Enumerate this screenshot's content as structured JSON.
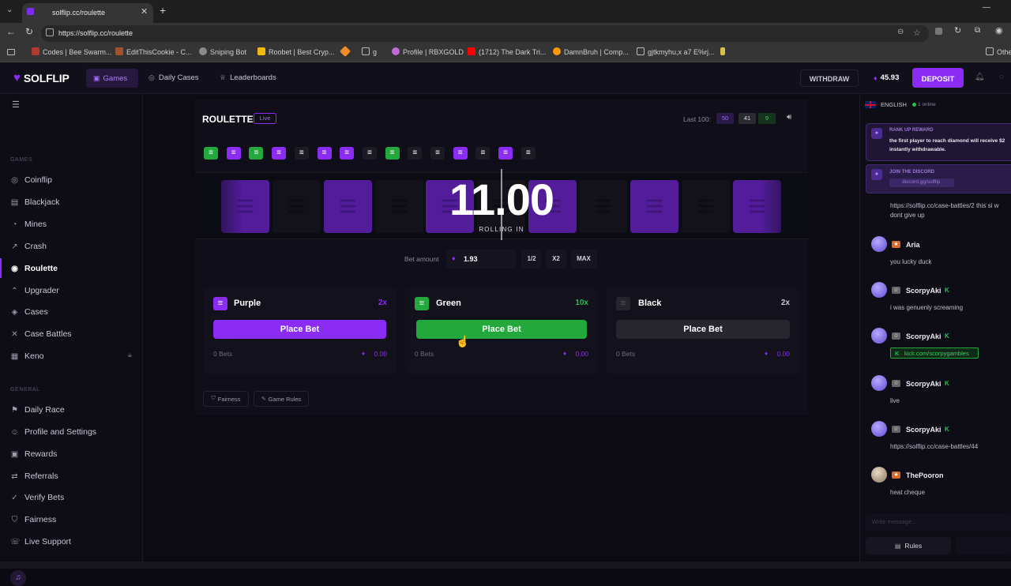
{
  "browser": {
    "tab_title": "solflip.cc/roulette",
    "url": "https://solflip.cc/roulette",
    "bookmarks": [
      {
        "label": "Codes | Bee Swarm...",
        "color": "#b03a2e"
      },
      {
        "label": "EditThisCookie - C...",
        "color": "#a0522d"
      },
      {
        "label": "Sniping Bot",
        "color": "#8a8a8a"
      },
      {
        "label": "Roobet | Best Cryp...",
        "color": "#f0b90b"
      },
      {
        "label": "",
        "color": "#f28c28"
      },
      {
        "label": "g",
        "color": "#aaaaaa"
      },
      {
        "label": "Profile | RBXGOLD",
        "color": "#c06bd6"
      },
      {
        "label": "(1712) The Dark Tri...",
        "color": "#ff0000"
      },
      {
        "label": "DamnBruh | Comp...",
        "color": "#ff9900"
      },
      {
        "label": "gjtkmyhu,x a7 E%rj...",
        "color": "#aaaaaa"
      }
    ],
    "other_bookmarks": "Othe"
  },
  "nav": {
    "logo": "SOLFLIP",
    "items": [
      {
        "label": "Games",
        "active": true
      },
      {
        "label": "Daily Cases",
        "active": false
      },
      {
        "label": "Leaderboards",
        "active": false
      }
    ],
    "withdraw": "WITHDRAW",
    "balance": "45.93",
    "deposit": "DEPOSIT"
  },
  "sidebar": {
    "games_header": "GAMES",
    "games": [
      {
        "label": "Coinflip",
        "icon": "coin-icon"
      },
      {
        "label": "Blackjack",
        "icon": "cards-icon"
      },
      {
        "label": "Mines",
        "icon": "bomb-icon"
      },
      {
        "label": "Crash",
        "icon": "rocket-icon"
      },
      {
        "label": "Roulette",
        "icon": "roulette-icon",
        "active": true
      },
      {
        "label": "Upgrader",
        "icon": "upgrade-icon"
      },
      {
        "label": "Cases",
        "icon": "case-icon"
      },
      {
        "label": "Case Battles",
        "icon": "swords-icon"
      },
      {
        "label": "Keno",
        "icon": "grid-icon",
        "locked": true
      }
    ],
    "general_header": "GENERAL",
    "general": [
      {
        "label": "Daily Race",
        "icon": "flag-icon"
      },
      {
        "label": "Profile and Settings",
        "icon": "user-icon"
      },
      {
        "label": "Rewards",
        "icon": "gift-icon"
      },
      {
        "label": "Referrals",
        "icon": "referral-icon"
      },
      {
        "label": "Verify Bets",
        "icon": "check-icon"
      },
      {
        "label": "Fairness",
        "icon": "shield-icon"
      },
      {
        "label": "Live Support",
        "icon": "support-icon"
      }
    ]
  },
  "game": {
    "title": "ROULETTE",
    "live_badge": "Live",
    "last100_label": "Last 100:",
    "last100": {
      "purple": "50",
      "black": "41",
      "green": "9"
    },
    "history": [
      "green",
      "purple",
      "green",
      "purple",
      "black",
      "purple",
      "purple",
      "black",
      "green",
      "black",
      "black",
      "purple",
      "black",
      "purple",
      "black"
    ],
    "countdown": "11.00",
    "rolling_label": "ROLLING IN",
    "bet_amount_label": "Bet amount",
    "bet_amount": "1.93",
    "half": "1/2",
    "double": "X2",
    "max": "MAX",
    "options": [
      {
        "name": "Purple",
        "multiplier": "2x",
        "button": "Place Bet",
        "bets": "0 Bets",
        "total": "0.00",
        "color": "#8b2cf5"
      },
      {
        "name": "Green",
        "multiplier": "10x",
        "button": "Place Bet",
        "bets": "0 Bets",
        "total": "0.00",
        "color": "#22a83c"
      },
      {
        "name": "Black",
        "multiplier": "2x",
        "button": "Place Bet",
        "bets": "0 Bets",
        "total": "0.00",
        "color": "#2a2a2f"
      }
    ],
    "fairness": "Fairness",
    "game_rules": "Game Rules"
  },
  "chat": {
    "language": "ENGLISH",
    "online": "1 online",
    "banner1_title": "RANK UP REWARD",
    "banner1_text1": "the first player to reach diamond will receive $2",
    "banner1_text2": "instantly withdrawable.",
    "banner2_title": "JOIN THE DISCORD",
    "banner2_link": "discord.gg/solflip",
    "overflow_text1": "https://solflip.cc/case-battles/2 this si w",
    "overflow_text2": "dont give up",
    "messages": [
      {
        "user": "Aria",
        "text": "you lucky duck",
        "rank": "#d66a2a"
      },
      {
        "user": "ScorpyAki",
        "text": "i was genuenly screaming",
        "rank": "#777777",
        "kick": true
      },
      {
        "user": "ScorpyAki",
        "text": "kick.com/scorpygambles",
        "rank": "#777777",
        "kick": true,
        "link": true
      },
      {
        "user": "ScorpyAki",
        "text": "live",
        "rank": "#777777",
        "kick": true
      },
      {
        "user": "ScorpyAki",
        "text": "https://solflip.cc/case-battles/44",
        "rank": "#777777",
        "kick": true
      },
      {
        "user": "ThePooron",
        "text": "heat cheque",
        "rank": "#d66a2a"
      }
    ],
    "kick_badge": "K",
    "input_placeholder": "Write message...",
    "rules": "Rules"
  }
}
